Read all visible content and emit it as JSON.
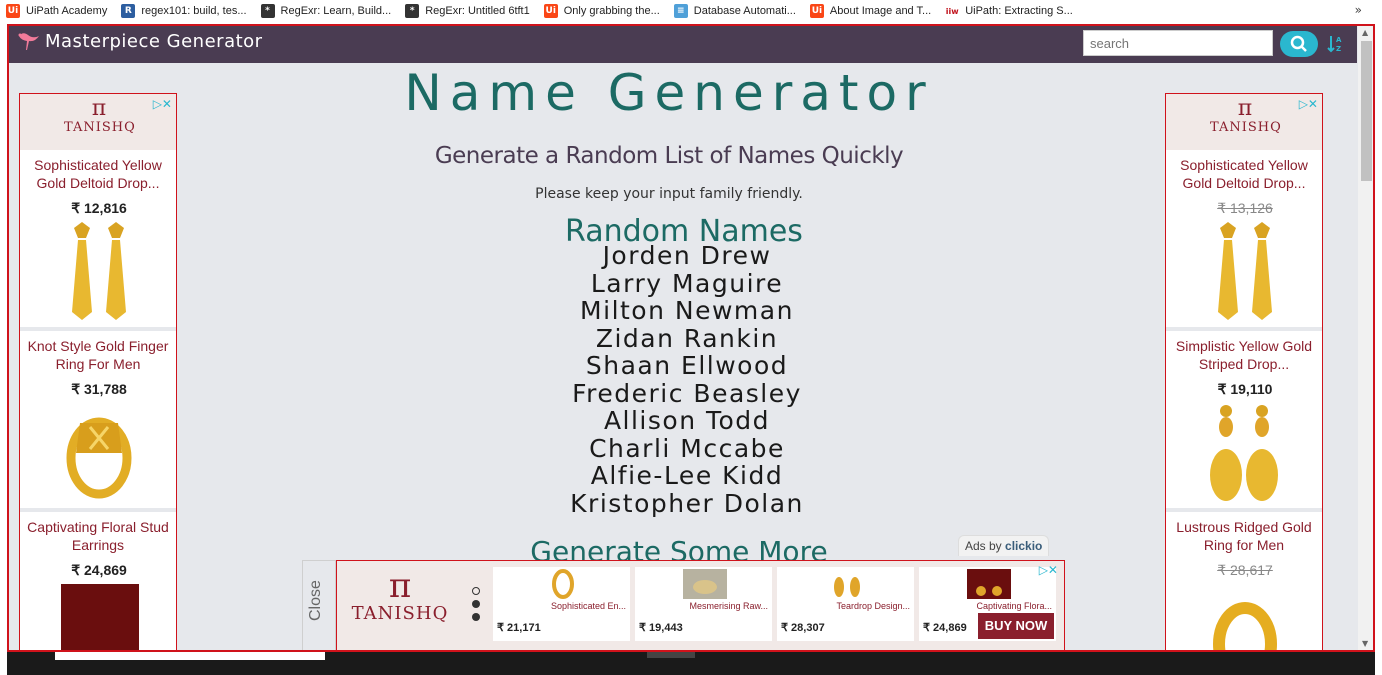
{
  "bookmarks": {
    "items": [
      {
        "label": "UiPath Academy",
        "icon": "uipath-icon",
        "color": "#fa4616"
      },
      {
        "label": "regex101: build, tes...",
        "icon": "regex101-icon",
        "color": "#2d5ea0"
      },
      {
        "label": "RegExr: Learn, Build...",
        "icon": "regexr-icon",
        "color": "#333333"
      },
      {
        "label": "RegExr: Untitled 6tft1",
        "icon": "regexr-icon",
        "color": "#333333"
      },
      {
        "label": "Only grabbing the...",
        "icon": "uipath-icon",
        "color": "#fa4616"
      },
      {
        "label": "Database Automati...",
        "icon": "database-icon",
        "color": "#4fa0d8"
      },
      {
        "label": "About Image and T...",
        "icon": "uipath-icon",
        "color": "#fa4616"
      },
      {
        "label": "UiPath: Extracting S...",
        "icon": "iiw-icon",
        "color": "#c0101a"
      }
    ],
    "more": "»"
  },
  "navbar": {
    "brand": "Masterpiece Generator",
    "search_placeholder": "search",
    "search_icon": "search-icon",
    "sort_icon": "sort-alpha-icon",
    "accent_color": "#2ab7cf",
    "bg_color": "#4a3c52"
  },
  "main": {
    "title": "Name Generator",
    "subtitle": "Generate a Random List of Names Quickly",
    "note": "Please keep your input family friendly.",
    "heading": "Random Names",
    "names": [
      "Jorden Drew",
      "Larry Maguire",
      "Milton Newman",
      "Zidan Rankin",
      "Shaan Ellwood",
      "Frederic Beasley",
      "Allison Todd",
      "Charli Mccabe",
      "Alfie-Lee Kidd",
      "Kristopher Dolan"
    ],
    "generate_more": "Generate Some More"
  },
  "left_ad": {
    "brand": "TANISHQ",
    "items": [
      {
        "name": "Sophisticated Yellow Gold Deltoid Drop...",
        "price": "₹ 12,816",
        "strike": false
      },
      {
        "name": "Knot Style Gold Finger Ring For Men",
        "price": "₹ 31,788",
        "strike": false
      },
      {
        "name": "Captivating Floral Stud Earrings",
        "price": "₹ 24,869",
        "strike": false
      }
    ]
  },
  "right_ad": {
    "brand": "TANISHQ",
    "items": [
      {
        "name": "Sophisticated Yellow Gold Deltoid Drop...",
        "price": "₹ 13,126",
        "strike": true
      },
      {
        "name": "Simplistic Yellow Gold Striped Drop...",
        "price": "₹ 19,110",
        "strike": false
      },
      {
        "name": "Lustrous Ridged Gold Ring for Men",
        "price": "₹ 28,617",
        "strike": true
      }
    ]
  },
  "bottom_ad": {
    "close_label": "Close",
    "ads_by_prefix": "Ads by",
    "ads_by_brand": "clickio",
    "brand": "TANISHQ",
    "items": [
      {
        "name": "Sophisticated En...",
        "price": "₹ 21,171"
      },
      {
        "name": "Mesmerising Raw...",
        "price": "₹ 19,443"
      },
      {
        "name": "Teardrop Design...",
        "price": "₹ 28,307"
      },
      {
        "name": "Captivating Flora...",
        "price": "₹ 24,869"
      }
    ],
    "buy_now": "BUY NOW"
  }
}
